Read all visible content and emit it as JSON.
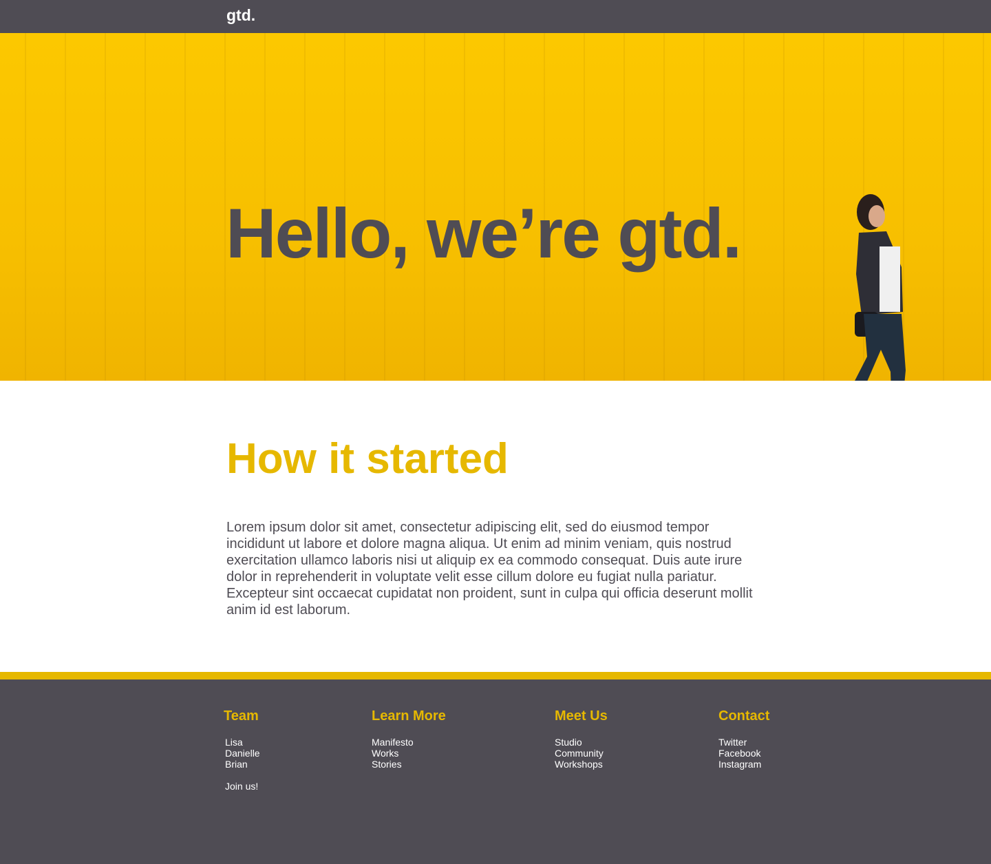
{
  "header": {
    "logo": "gtd."
  },
  "hero": {
    "title": "Hello, we’re gtd."
  },
  "about": {
    "title": "How it started",
    "body": "Lorem ipsum dolor sit amet, consectetur adipiscing elit, sed do eiusmod tempor incididunt ut labore et dolore magna aliqua. Ut enim ad minim veniam, quis nostrud exercitation ullamco laboris nisi ut aliquip ex ea commodo consequat. Duis aute irure dolor in reprehenderit in voluptate velit esse cillum dolore eu fugiat nulla pariatur. Excepteur sint occaecat cupidatat non proident, sunt in culpa qui officia deserunt mollit anim id est laborum."
  },
  "footer": {
    "team": {
      "title": "Team",
      "links": [
        "Lisa",
        "Danielle",
        "Brian"
      ],
      "join": "Join us!"
    },
    "learn": {
      "title": "Learn More",
      "links": [
        "Manifesto",
        "Works",
        "Stories"
      ]
    },
    "meet": {
      "title": "Meet Us",
      "links": [
        "Studio",
        "Community",
        "Workshops"
      ]
    },
    "contact": {
      "title": "Contact",
      "links": [
        "Twitter",
        "Facebook",
        "Instagram"
      ]
    }
  }
}
